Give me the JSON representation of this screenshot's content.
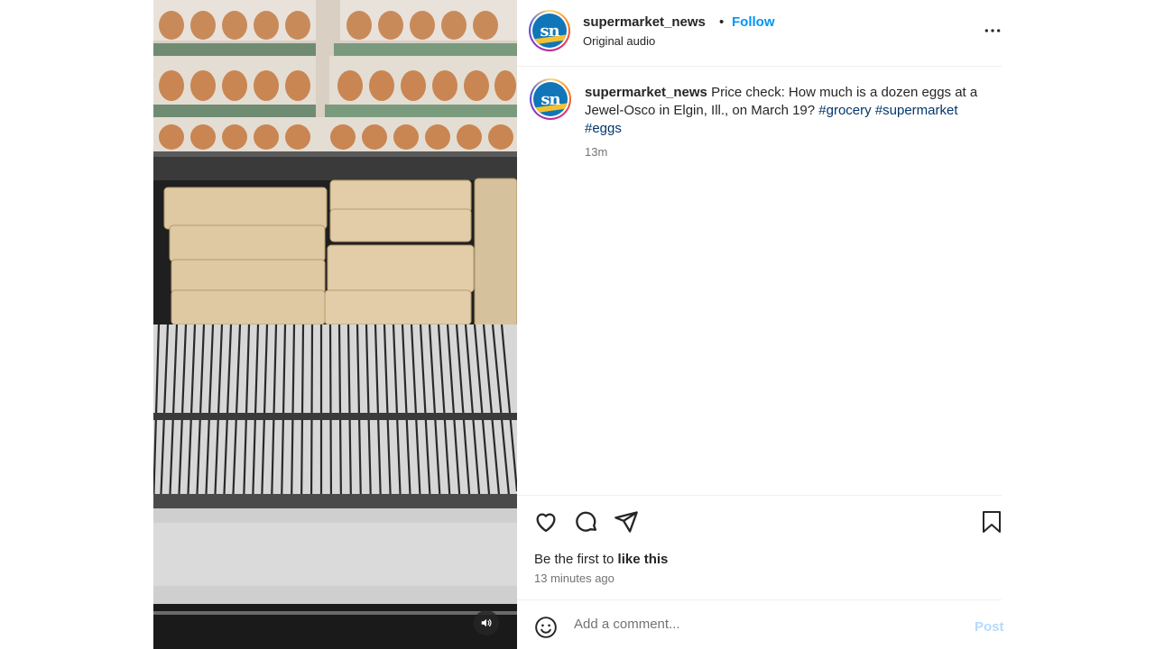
{
  "post": {
    "username": "supermarket_news",
    "follow_label": "Follow",
    "separator": "•",
    "audio_label": "Original audio",
    "avatar_initials": "sn"
  },
  "caption": {
    "username": "supermarket_news",
    "text": " Price check: How much is a dozen eggs at a Jewel-Osco in Elgin, Ill., on March 19? ",
    "hashtags": [
      "#grocery",
      "#supermarket",
      "#eggs"
    ],
    "time": "13m"
  },
  "engagement": {
    "likes_prefix": "Be the first to ",
    "likes_action": "like this",
    "posted_ago": "13 minutes ago"
  },
  "comment": {
    "placeholder": "Add a comment...",
    "post_label": "Post"
  },
  "icons": {
    "more": "more-horizontal-icon",
    "like": "heart-icon",
    "comment": "comment-bubble-icon",
    "share": "paper-plane-icon",
    "save": "bookmark-icon",
    "emoji": "smiley-icon",
    "mute": "speaker-icon"
  },
  "colors": {
    "link_blue": "#0095f6",
    "hashtag_blue": "#00376b",
    "muted_text": "#737373",
    "post_disabled": "#b3dbff",
    "divider": "#efefef"
  }
}
